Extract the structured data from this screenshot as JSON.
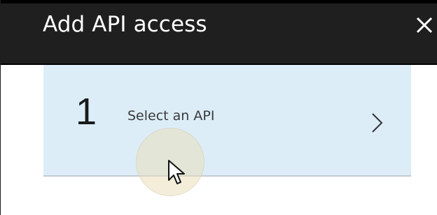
{
  "blade": {
    "title": "Add API access",
    "close_icon": "close-icon"
  },
  "steps": [
    {
      "number": "1",
      "label": "Select an API",
      "chevron_icon": "chevron-right-icon"
    }
  ],
  "cursor": {
    "icon": "mouse-pointer-icon"
  },
  "colors": {
    "header_bg": "#1f1f1f",
    "step_bg": "#dcedf8",
    "step_border": "#c4cbd2"
  }
}
